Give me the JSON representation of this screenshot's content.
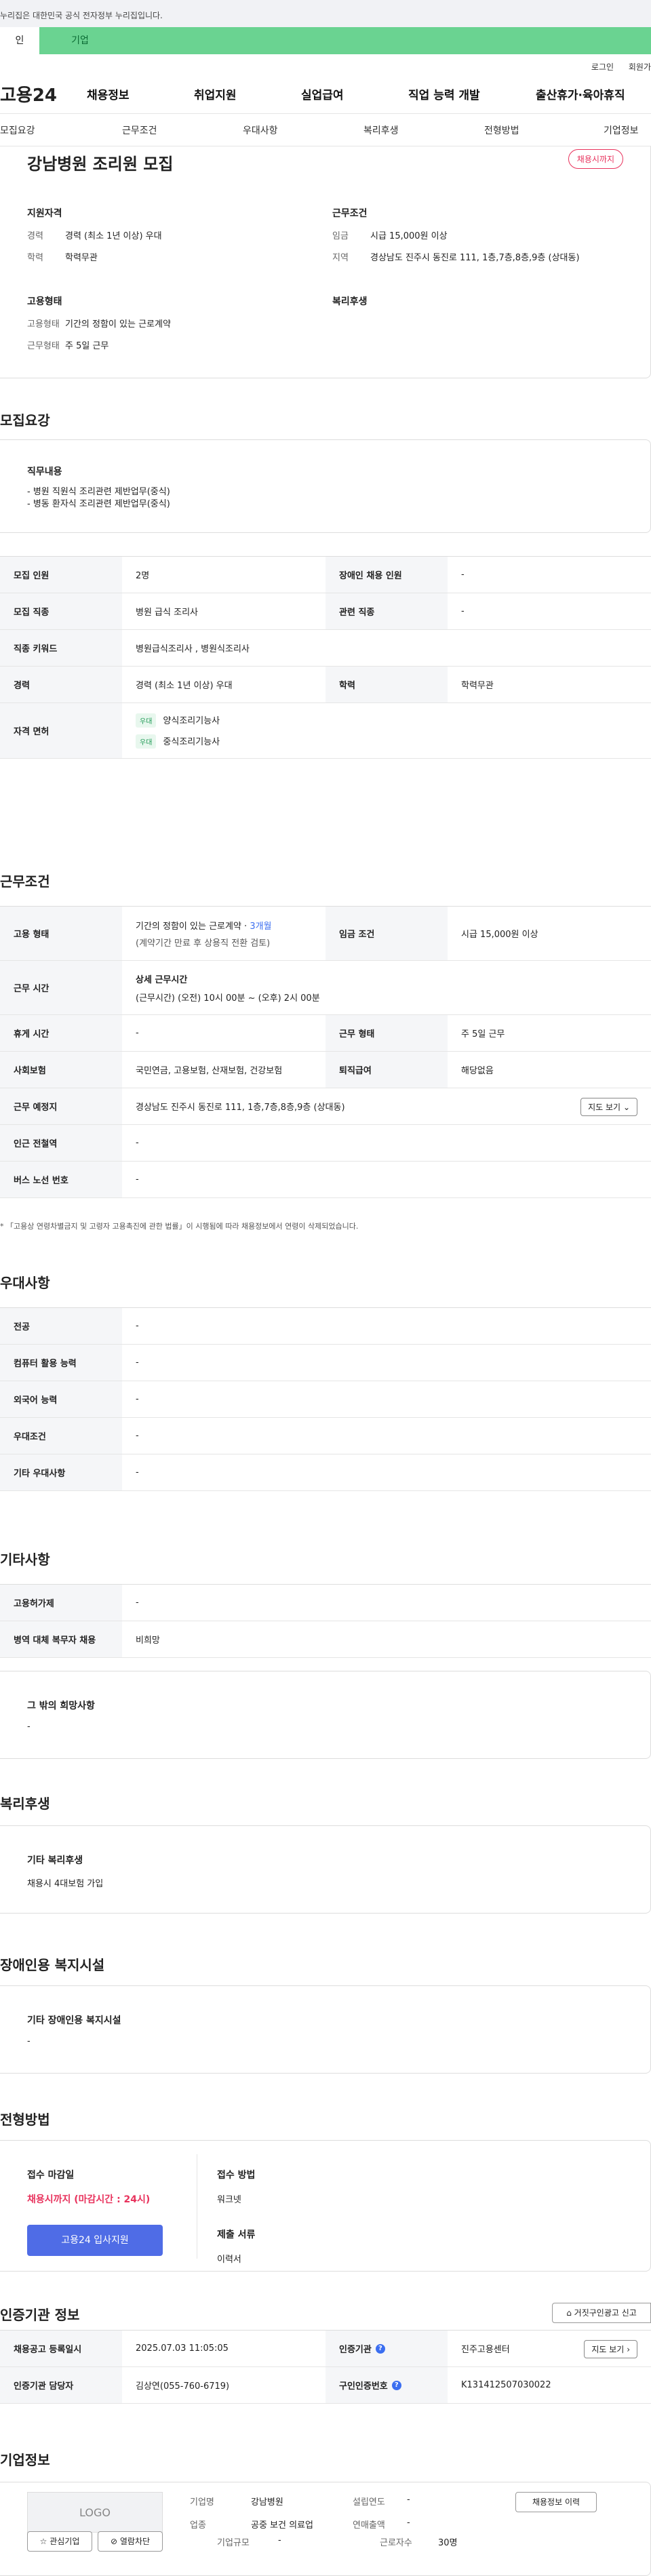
{
  "gov_banner": "누리집은 대한민국 공식 전자정부 누리집입니다.",
  "user_tabs": {
    "personal": "인",
    "company": "기업"
  },
  "top_links": {
    "login": "로그인",
    "signup": "회원가"
  },
  "logo": "고용24",
  "gnb": [
    "채용정보",
    "취업지원",
    "실업급여",
    "직업 능력 개발",
    "출산휴가·육아휴직"
  ],
  "anchors": [
    "모집요강",
    "근무조건",
    "우대사항",
    "복리후생",
    "전형방법",
    "기업정보"
  ],
  "job": {
    "title": "강남병원 조리원 모집",
    "badge": "채용시까지",
    "qualification_title": "지원자격",
    "career_label": "경력",
    "career_value": "경력 (최소 1년 이상) 우대",
    "education_label": "학력",
    "education_value": "학력무관",
    "employment_title": "고용형태",
    "employment_label": "고용형태",
    "employment_value": "기간의 정함이 있는 근로계약",
    "worktype_label": "근무형태",
    "worktype_value": "주 5일 근무",
    "conditions_title": "근무조건",
    "wage_label": "임금",
    "wage_value": "시급 15,000원 이상",
    "region_label": "지역",
    "region_value": "경상남도 진주시 동진로 111, 1층,7층,8층,9층 (상대동)",
    "welfare_title": "복리후생"
  },
  "recruit": {
    "title": "모집요강",
    "duty_title": "직무내용",
    "duty_lines": [
      "- 병원 직원식 조리관련 제반업무(중식)",
      "- 병동 환자식 조리관련 제반업무(중식)"
    ],
    "headcount_label": "모집 인원",
    "headcount_value": "2명",
    "disabled_label": "장애인 채용 인원",
    "disabled_value": "-",
    "job_label": "모집 직종",
    "job_value": "병원 급식 조리사",
    "related_label": "관련 직종",
    "related_value": "-",
    "keyword_label": "직종 키워드",
    "keyword_value": "병원급식조리사 , 병원식조리사",
    "career_label": "경력",
    "career_value": "경력 (최소 1년 이상) 우대",
    "edu_label": "학력",
    "edu_value": "학력무관",
    "license_label": "자격 면허",
    "license_tag": "우대",
    "licenses": [
      "양식조리기능사",
      "중식조리기능사"
    ]
  },
  "work": {
    "title": "근무조건",
    "type_label": "고용 형태",
    "type_value": "기간의 정함이 있는 근로계약 · ",
    "type_months": "3개월",
    "type_note": "(계약기간 만료 후 상용직 전환 검토)",
    "wage_label": "임금 조건",
    "wage_value": "시급 15,000원 이상",
    "time_label": "근무 시간",
    "time_title": "상세 근무시간",
    "time_value": "(근무시간) (오전) 10시 00분 ~ (오후) 2시 00분",
    "break_label": "휴게 시간",
    "break_value": "-",
    "worktype_label": "근무 형태",
    "worktype_value": "주 5일 근무",
    "insurance_label": "사회보험",
    "insurance_value": "국민연금, 고용보험, 산재보험, 건강보험",
    "severance_label": "퇴직급여",
    "severance_value": "해당없음",
    "place_label": "근무 예정지",
    "place_value": "경상남도 진주시 동진로 111, 1층,7층,8층,9층 (상대동)",
    "map_button": "지도 보기",
    "subway_label": "인근 전철역",
    "subway_value": "-",
    "bus_label": "버스 노선 번호",
    "bus_value": "-",
    "footnote": "* 「고용상 연령차별금지 및 고령자 고용촉진에 관한 법률」이 시행됨에 따라 채용정보에서 연령이 삭제되었습니다."
  },
  "pref": {
    "title": "우대사항",
    "rows": [
      {
        "label": "전공",
        "value": "-"
      },
      {
        "label": "컴퓨터 활용 능력",
        "value": "-"
      },
      {
        "label": "외국어 능력",
        "value": "-"
      },
      {
        "label": "우대조건",
        "value": "-"
      },
      {
        "label": "기타 우대사항",
        "value": "-"
      }
    ]
  },
  "etc": {
    "title": "기타사항",
    "housing_label": "고용허가제",
    "housing_value": "-",
    "military_label": "병역 대체 복무자 채용",
    "military_value": "비희망",
    "other_title": "그 밖의 희망사항",
    "other_value": "-"
  },
  "welfare": {
    "title": "복리후생",
    "box_title": "기타 복리후생",
    "box_value": "채용시 4대보험 가입"
  },
  "facility": {
    "title": "장애인용 복지시설",
    "box_title": "기타 장애인용 복지시설",
    "box_value": "-"
  },
  "process": {
    "title": "전형방법",
    "deadline_label": "접수 마감일",
    "deadline_value": "채용시까지 (마감시간 : 24시)",
    "apply_button": "고용24 입사지원",
    "method_label": "접수 방법",
    "method_value": "워크넷",
    "docs_label": "제출 서류",
    "docs_value": "이력서"
  },
  "cert": {
    "title": "인증기관 정보",
    "report_button": "거짓구인광고 신고",
    "reg_label": "채용공고 등록일시",
    "reg_value": "2025.07.03 11:05:05",
    "agency_label": "인증기관",
    "agency_value": "진주고용센터",
    "map_button": "지도 보기",
    "manager_label": "인증기관 담당자",
    "manager_value": "김상연(055-760-6719)",
    "number_label": "구인인증번호",
    "number_value": "K131412507030022"
  },
  "company": {
    "title": "기업정보",
    "logo": "LOGO",
    "interest_button": "관심기업",
    "block_button": "열람차단",
    "name_label": "기업명",
    "name_value": "강남병원",
    "founded_label": "설립연도",
    "founded_value": "-",
    "industry_label": "업종",
    "industry_value": "공중 보건 의료업",
    "sales_label": "연매출액",
    "sales_value": "-",
    "size_label": "기업규모",
    "size_value": "-",
    "employees_label": "근로자수",
    "employees_value": "30명",
    "history_button": "채용정보 이력"
  },
  "colors": {
    "brand_green": "#6ad391",
    "accent_red": "#e8335d",
    "primary_blue": "#4f6ce6"
  }
}
